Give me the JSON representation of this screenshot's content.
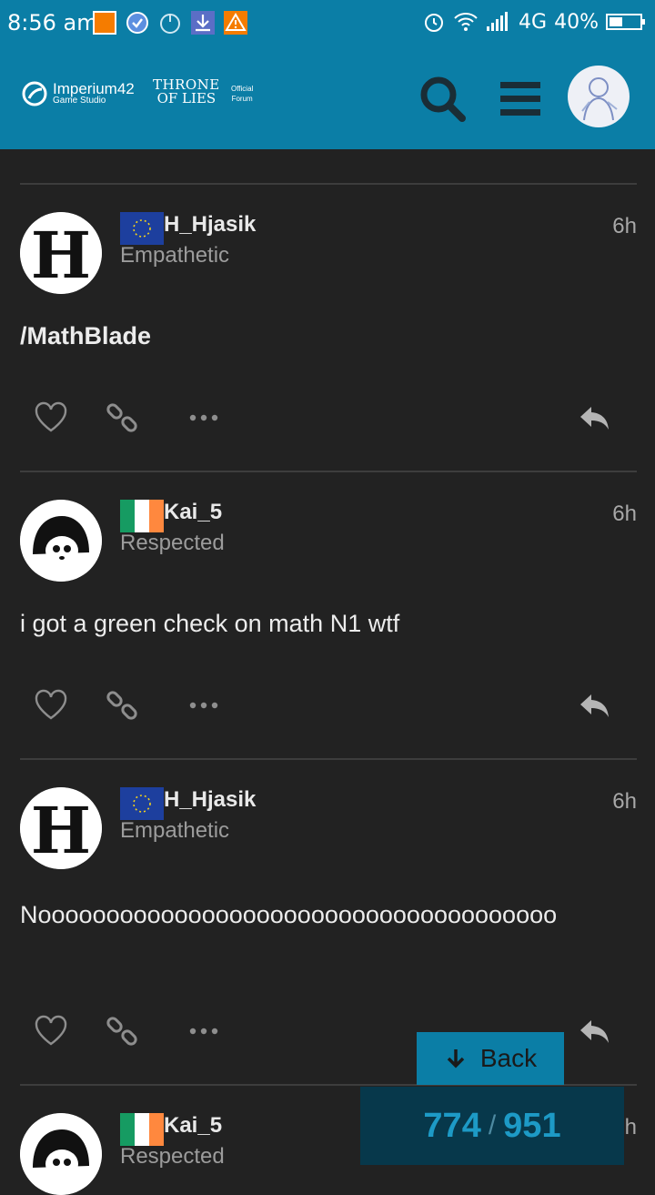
{
  "status_bar": {
    "time": "8:56 am",
    "network": "4G",
    "battery": "40%"
  },
  "header": {
    "studio_name": "Imperium42",
    "studio_sub": "Game Studio",
    "game_logo_line1": "THRONE",
    "game_logo_line2": "OF LIES",
    "forum_line1": "Official",
    "forum_line2": "Forum",
    "search_icon": "search-icon",
    "menu_icon": "hamburger-menu-icon"
  },
  "posts": [
    {
      "username": "H_Hjasik",
      "flag": "EU",
      "user_title": "Empathetic",
      "time": "6h",
      "body": "/MathBlade"
    },
    {
      "username": "Kai_5",
      "flag": "IE",
      "user_title": "Respected",
      "time": "6h",
      "body": "i got a green check on math N1 wtf"
    },
    {
      "username": "H_Hjasik",
      "flag": "EU",
      "user_title": "Empathetic",
      "time": "6h",
      "body": "Noooooooooooooooooooooooooooooooooooooo"
    },
    {
      "username": "Kai_5",
      "flag": "IE",
      "user_title": "Respected",
      "time": "h",
      "body": ""
    }
  ],
  "timeline": {
    "back_label": "Back",
    "current": "774",
    "separator": "/",
    "total": "951"
  },
  "colors": {
    "header_bg": "#0b7ea6",
    "page_bg": "#222222",
    "progress_bg": "#07384b",
    "progress_text": "#1d9ac6"
  }
}
